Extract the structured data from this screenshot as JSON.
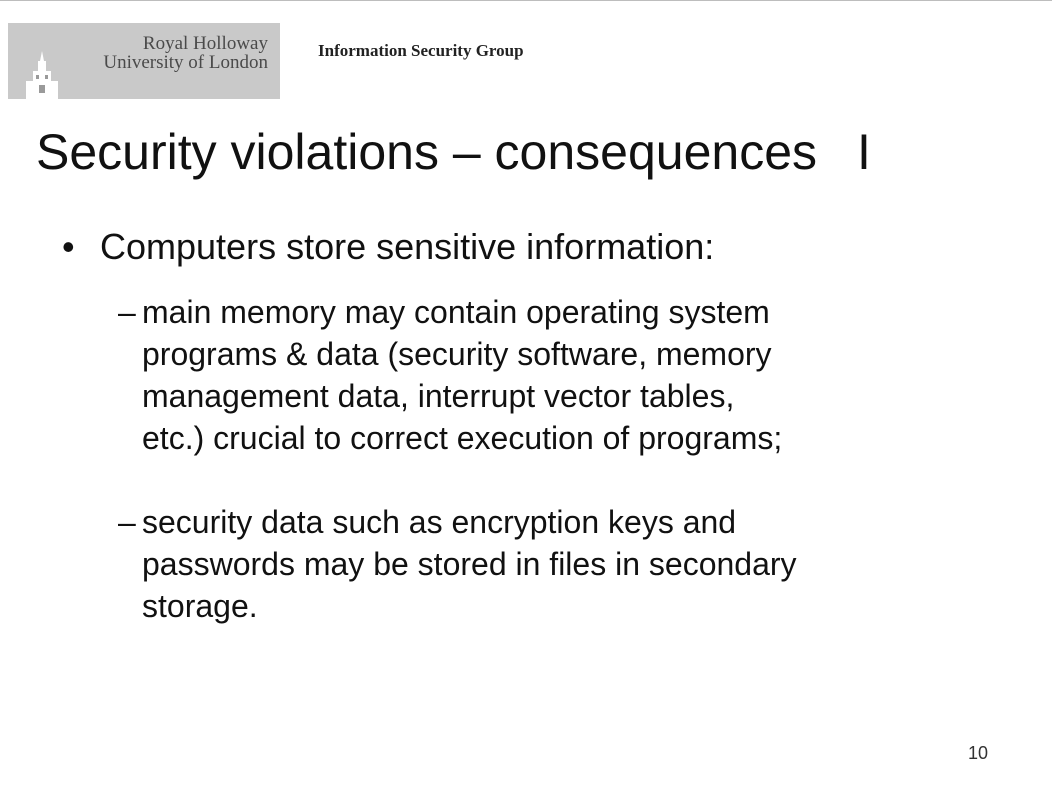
{
  "header": {
    "logo_line1": "Royal Holloway",
    "logo_line2": "University of London",
    "group_name": "Information Security Group"
  },
  "slide": {
    "title": "Security violations – consequences",
    "title_suffix": "I",
    "bullets": [
      {
        "marker": "•",
        "text": "Computers store sensitive information:",
        "sub_bullets": [
          {
            "marker": "–",
            "lines": [
              "main memory may contain operating system",
              "programs & data (security software, memory",
              "management data, interrupt vector tables,",
              "etc.) crucial to correct execution of programs;"
            ]
          },
          {
            "marker": "–",
            "lines": [
              "security data such as encryption keys and",
              "passwords may be stored in files in secondary",
              "storage."
            ]
          }
        ]
      }
    ],
    "page_number": "10"
  },
  "colors": {
    "logo_background": "#c9c9c9",
    "logo_text": "#4a4a4a",
    "text": "#111111"
  },
  "icons": {
    "logo_building": "building-tower-icon"
  }
}
